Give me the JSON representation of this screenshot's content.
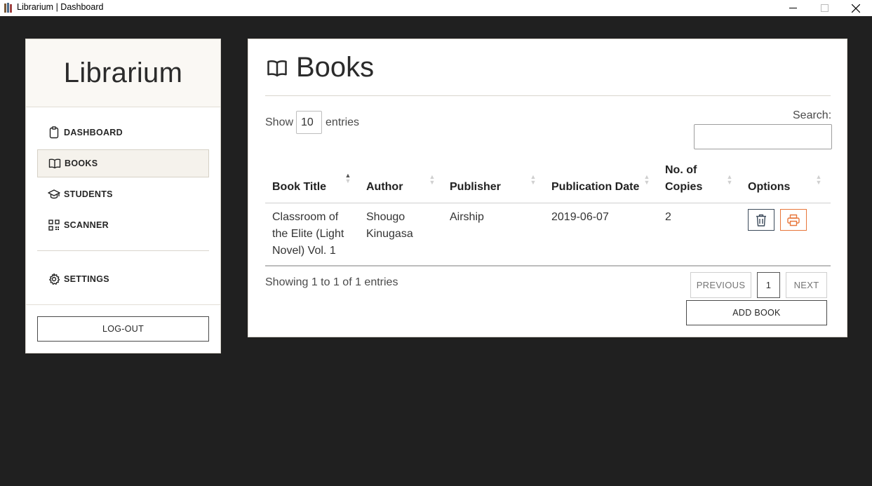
{
  "window": {
    "title": "Librarium | Dashboard"
  },
  "sidebar": {
    "brand": "Librarium",
    "items": [
      {
        "label": "DASHBOARD",
        "icon": "clipboard-icon"
      },
      {
        "label": "BOOKS",
        "icon": "book-open-icon",
        "active": true
      },
      {
        "label": "STUDENTS",
        "icon": "graduation-cap-icon"
      },
      {
        "label": "SCANNER",
        "icon": "qr-code-icon"
      }
    ],
    "settings": {
      "label": "SETTINGS",
      "icon": "gear-icon"
    },
    "logout_label": "LOG-OUT"
  },
  "main": {
    "title": "Books",
    "title_icon": "book-open-icon",
    "length": {
      "prefix": "Show",
      "value": "10",
      "suffix": "entries"
    },
    "search": {
      "label": "Search:",
      "value": ""
    },
    "table": {
      "columns": [
        "Book Title",
        "Author",
        "Publisher",
        "Publication Date",
        "No. of Copies",
        "Options"
      ],
      "sorted_column": "Book Title",
      "sort_direction": "ascending",
      "rows": [
        {
          "title": "Classroom of the Elite (Light Novel) Vol. 1",
          "author": "Shougo Kinugasa",
          "publisher": "Airship",
          "publication_date": "2019-06-07",
          "copies": "2"
        }
      ]
    },
    "info": "Showing 1 to 1 of 1 entries",
    "pagination": {
      "previous": "PREVIOUS",
      "current": "1",
      "next": "NEXT"
    },
    "add_label": "ADD BOOK"
  },
  "colors": {
    "background": "#202020",
    "panel": "#ffffff",
    "brand_bg": "#faf8f4",
    "active_item_bg": "#f5f2ec",
    "delete_accent": "#3c4a5a",
    "print_accent": "#e8763a"
  }
}
